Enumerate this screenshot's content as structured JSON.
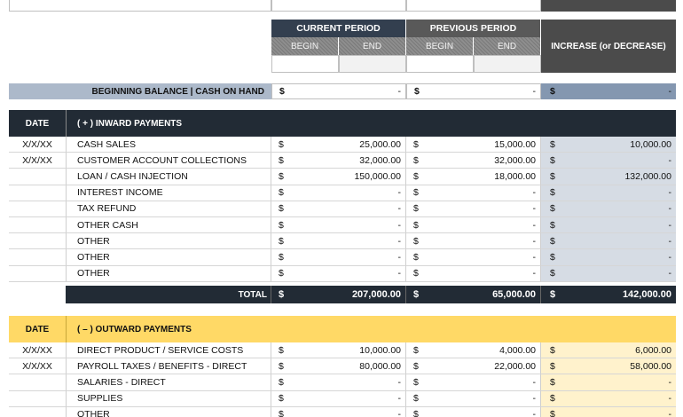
{
  "colors": {
    "dark_header": "#333f4f",
    "gray_header": "#595959",
    "increase_header": "#4b4b4b",
    "balance_label_bg": "#acb9ca",
    "balance_inc_bg": "#8497b0",
    "inward_inc_bg": "#d6dce4",
    "outward_header": "#ffd966",
    "outward_inc_bg": "#fff2cc",
    "total_bg": "#222b35"
  },
  "periods": {
    "current": "CURRENT PERIOD",
    "previous": "PREVIOUS PERIOD",
    "begin": "BEGIN",
    "end": "END",
    "increase": "INCREASE (or DECREASE)"
  },
  "beginning_balance": {
    "label": "BEGINNING BALANCE | CASH ON HAND",
    "current": "-",
    "previous": "-",
    "increase": "-"
  },
  "currency_symbol": "$",
  "inward": {
    "date_header": "DATE",
    "title": "( + )  INWARD PAYMENTS",
    "rows": [
      {
        "date": "X/X/XX",
        "desc": "CASH SALES",
        "cur": "25,000.00",
        "prev": "15,000.00",
        "inc": "10,000.00"
      },
      {
        "date": "X/X/XX",
        "desc": "CUSTOMER ACCOUNT COLLECTIONS",
        "cur": "32,000.00",
        "prev": "32,000.00",
        "inc": "-"
      },
      {
        "date": "",
        "desc": "LOAN / CASH INJECTION",
        "cur": "150,000.00",
        "prev": "18,000.00",
        "inc": "132,000.00"
      },
      {
        "date": "",
        "desc": "INTEREST INCOME",
        "cur": "-",
        "prev": "-",
        "inc": "-"
      },
      {
        "date": "",
        "desc": "TAX REFUND",
        "cur": "-",
        "prev": "-",
        "inc": "-"
      },
      {
        "date": "",
        "desc": "OTHER CASH",
        "cur": "-",
        "prev": "-",
        "inc": "-"
      },
      {
        "date": "",
        "desc": "OTHER",
        "cur": "-",
        "prev": "-",
        "inc": "-"
      },
      {
        "date": "",
        "desc": "OTHER",
        "cur": "-",
        "prev": "-",
        "inc": "-"
      },
      {
        "date": "",
        "desc": "OTHER",
        "cur": "-",
        "prev": "-",
        "inc": "-"
      }
    ],
    "total": {
      "label": "TOTAL",
      "cur": "207,000.00",
      "prev": "65,000.00",
      "inc": "142,000.00"
    }
  },
  "outward": {
    "date_header": "DATE",
    "title": "( – )  OUTWARD PAYMENTS",
    "rows": [
      {
        "date": "X/X/XX",
        "desc": "DIRECT PRODUCT / SERVICE COSTS",
        "cur": "10,000.00",
        "prev": "4,000.00",
        "inc": "6,000.00"
      },
      {
        "date": "X/X/XX",
        "desc": "PAYROLL TAXES / BENEFITS - DIRECT",
        "cur": "80,000.00",
        "prev": "22,000.00",
        "inc": "58,000.00"
      },
      {
        "date": "",
        "desc": "SALARIES - DIRECT",
        "cur": "-",
        "prev": "-",
        "inc": "-"
      },
      {
        "date": "",
        "desc": "SUPPLIES",
        "cur": "-",
        "prev": "-",
        "inc": "-"
      },
      {
        "date": "",
        "desc": "OTHER",
        "cur": "-",
        "prev": "-",
        "inc": "-"
      }
    ]
  }
}
